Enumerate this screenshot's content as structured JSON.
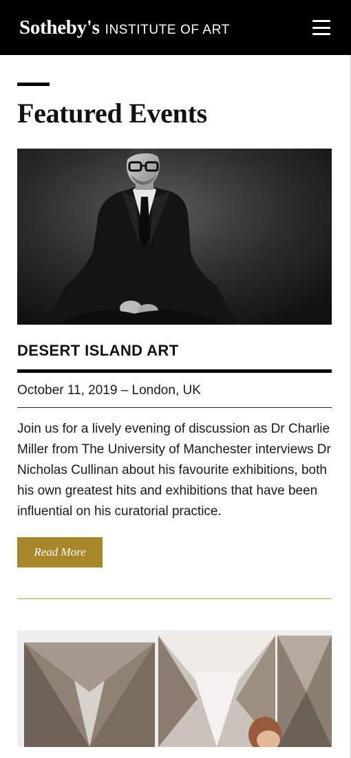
{
  "header": {
    "brand_name": "Sotheby's",
    "brand_sub": "INSTITUTE OF ART",
    "menu_icon": "hamburger-menu-icon",
    "background": "#000000"
  },
  "section": {
    "title": "Featured Events"
  },
  "events": [
    {
      "image": "portrait-photo",
      "title": "DESERT ISLAND ART",
      "meta": "October 11, 2019 – London, UK",
      "description": "Join us for a lively evening of discussion as Dr Charlie Miller from The University of Manchester interviews Dr Nicholas Cullinan about his favourite exhibitions, both his own greatest hits and exhibitions that have been influential on his curatorial practice.",
      "cta": "Read More"
    },
    {
      "image": "gallery-artwork-photo"
    }
  ],
  "colors": {
    "accent_gold": "#a8862a",
    "divider_gold": "#b99a4a",
    "text": "#111111"
  }
}
